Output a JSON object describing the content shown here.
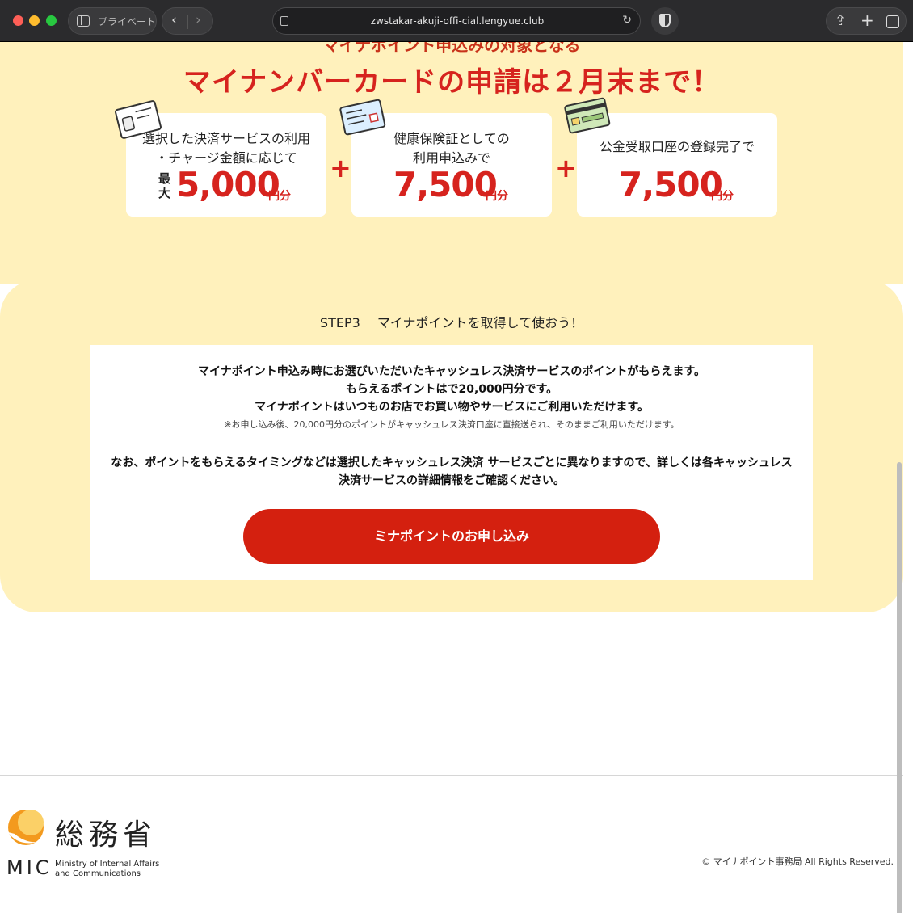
{
  "browser": {
    "private_label": "プライベート",
    "url": "zwstakar-akuji-offi-cial.lengyue.club"
  },
  "hero": {
    "subtitle": "マイナポイント申込みの対象となる",
    "title": "マイナンバーカードの申請は２月末まで！",
    "cards": [
      {
        "line1": "選択した決済サービスの利用",
        "line2": "・チャージ金額に応じて",
        "prefix": "最大",
        "amount": "5,000",
        "unit": "円分"
      },
      {
        "line1": "健康保険証としての",
        "line2": "利用申込みで",
        "amount": "7,500",
        "unit": "円分"
      },
      {
        "line1": "公金受取口座の登録完了で",
        "amount": "7,500",
        "unit": "円分"
      }
    ],
    "plus": "+"
  },
  "step3": {
    "title": "STEP3　 マイナポイントを取得して使おう！",
    "lines": [
      "マイナポイント申込み時にお選びいただいたキャッシュレス決済サービスのポイントがもらえます。",
      "もらえるポイントはで20,000円分です。",
      "マイナポイントはいつものお店でお買い物やサービスにご利用いただけます。"
    ],
    "note": "※お申し込み後、20,000円分のポイントがキャッシュレス決済口座に直接送られ、そのままご利用いただけます。",
    "body1": "なお、ポイントをもらえるタイミングなどは選択したキャッシュレス決済 サービスごとに異なりますので、詳しくは各キャッシュレス",
    "body2": "決済サービスの詳細情報をご確認ください。",
    "cta": "ミナポイントのお申し込み"
  },
  "footer": {
    "logo_kanji": "総務省",
    "logo_abbr": "MIC",
    "logo_en1": "Ministry of Internal Affairs",
    "logo_en2": "and Communications",
    "copyright": "© マイナポイント事務局 All Rights Reserved."
  }
}
